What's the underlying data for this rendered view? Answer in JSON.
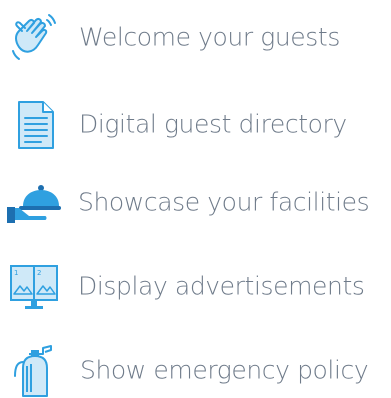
{
  "features": [
    {
      "label": "Welcome your guests",
      "icon": "waving-hand-icon"
    },
    {
      "label": "Digital guest directory",
      "icon": "document-icon"
    },
    {
      "label": "Showcase your facilities",
      "icon": "serving-cloche-icon"
    },
    {
      "label": "Display advertisements",
      "icon": "monitor-screens-icon"
    },
    {
      "label": "Show emergency policy",
      "icon": "fire-extinguisher-icon"
    }
  ],
  "colors": {
    "text": "#6f7b8a",
    "icon_blue": "#2fa0e0",
    "icon_light": "#cfe9f8",
    "icon_dark": "#1d6fb0"
  }
}
